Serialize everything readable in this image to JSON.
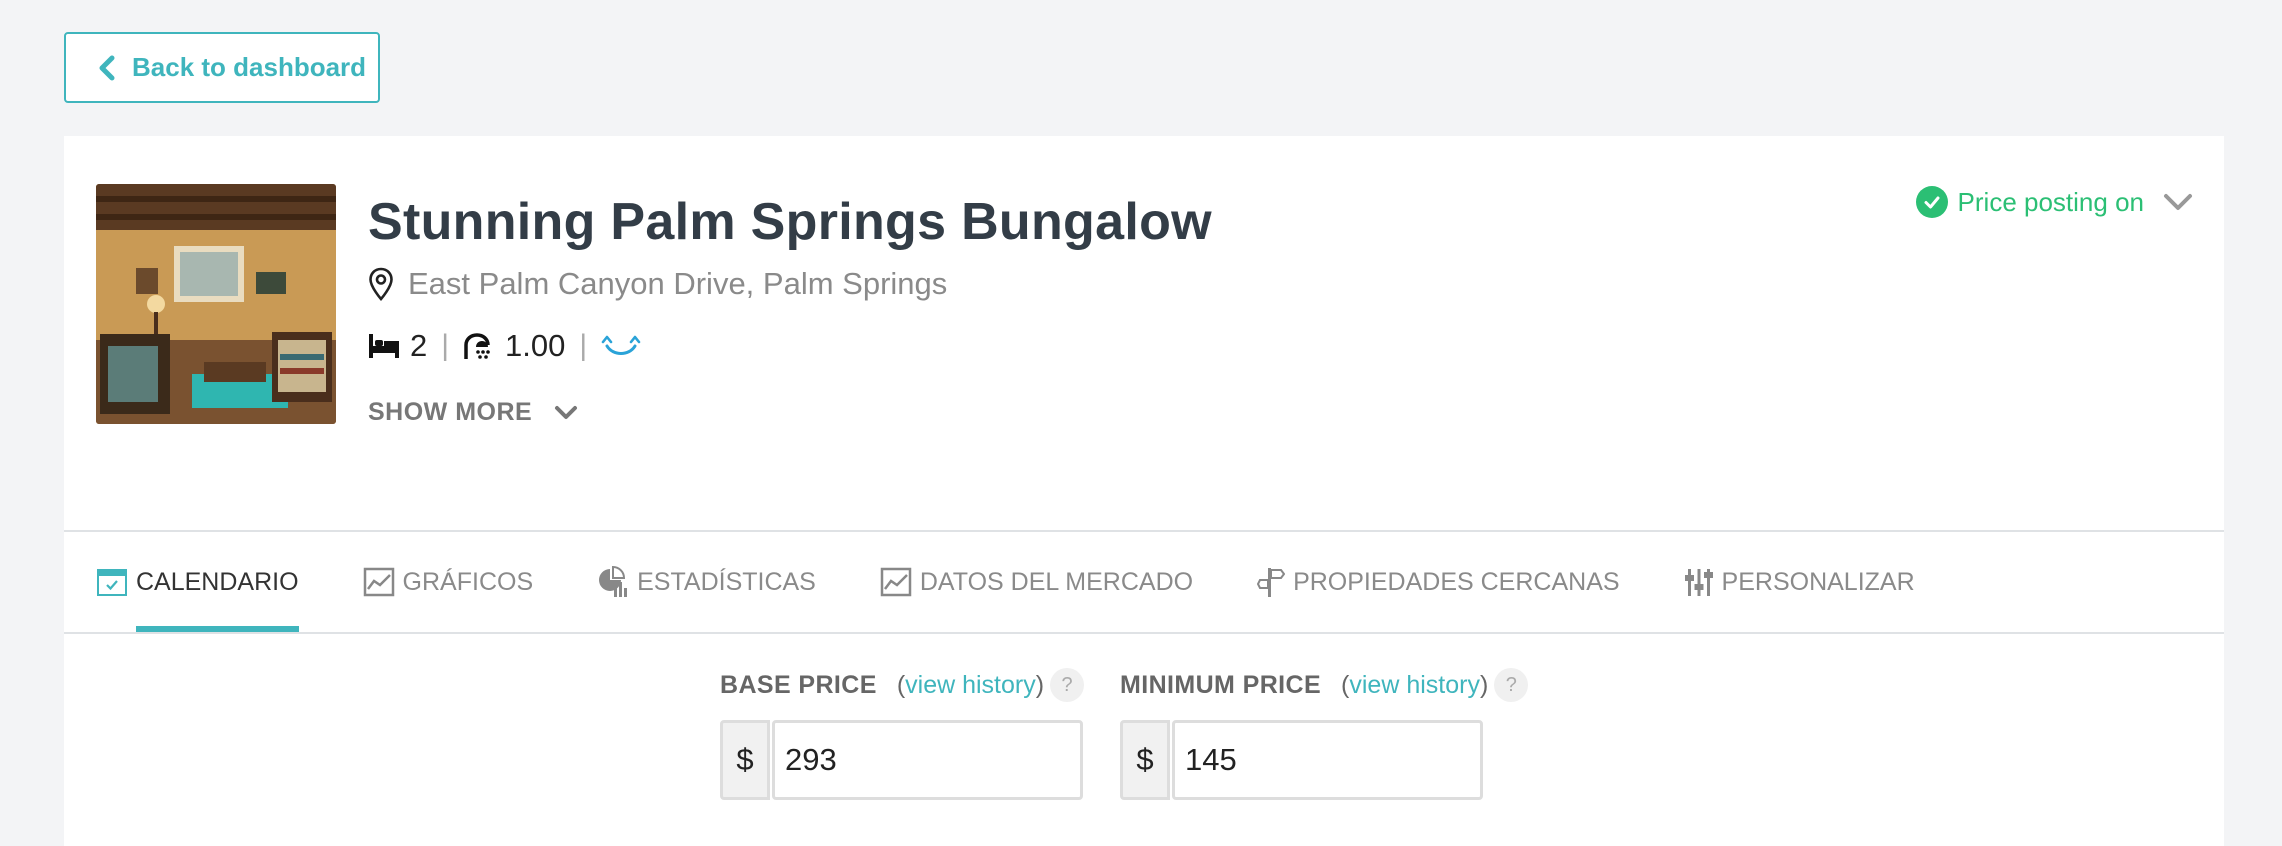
{
  "nav": {
    "back_label": "Back to dashboard"
  },
  "listing": {
    "title": "Stunning Palm Springs Bungalow",
    "address": "East Palm Canyon Drive, Palm Springs",
    "bedrooms": "2",
    "bathrooms": "1.00",
    "show_more_label": "SHOW MORE",
    "status": "Price posting on",
    "photo_alt": "interior living room photo"
  },
  "tabs": [
    {
      "label": "CALENDARIO",
      "icon": "calendar-icon",
      "active": true
    },
    {
      "label": "GRÁFICOS",
      "icon": "chart-icon",
      "active": false
    },
    {
      "label": "ESTADÍSTICAS",
      "icon": "stats-icon",
      "active": false
    },
    {
      "label": "DATOS DEL MERCADO",
      "icon": "market-chart-icon",
      "active": false
    },
    {
      "label": "PROPIEDADES CERCANAS",
      "icon": "signpost-icon",
      "active": false
    },
    {
      "label": "PERSONALIZAR",
      "icon": "sliders-icon",
      "active": false
    }
  ],
  "pricing": {
    "base": {
      "label": "BASE PRICE",
      "paren_open": "(",
      "link": "view history",
      "paren_close": ")",
      "help": "?",
      "currency": "$",
      "value": "293"
    },
    "minimum": {
      "label": "MINIMUM PRICE",
      "paren_open": "(",
      "link": "view history",
      "paren_close": ")",
      "help": "?",
      "currency": "$",
      "value": "145"
    }
  },
  "colors": {
    "accent": "#3fb5bd",
    "success": "#2bbf74",
    "title": "#333d47"
  }
}
